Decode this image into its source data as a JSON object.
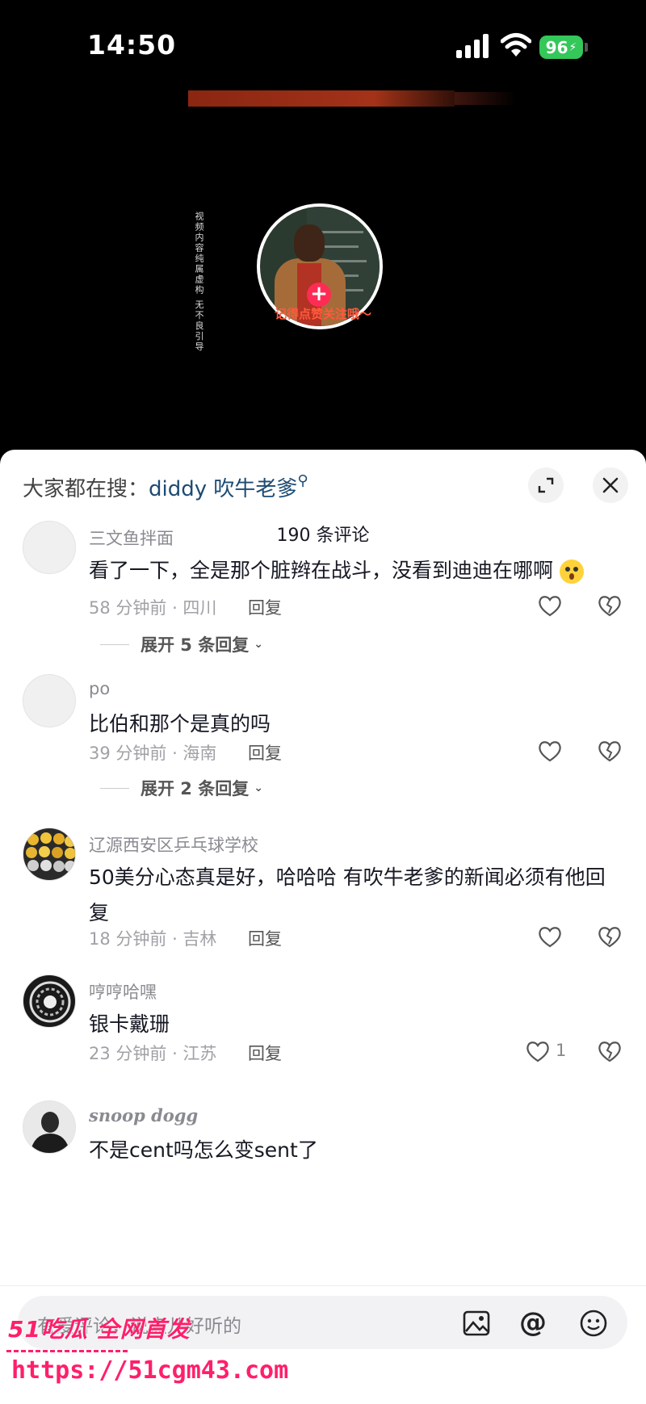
{
  "status_bar": {
    "time": "14:50",
    "battery": "96"
  },
  "video": {
    "vertical_note": "视频内容纯属虚构 无不良引导",
    "follow_hint": "记得点赞关注哦～",
    "follow_plus": "+"
  },
  "sheet": {
    "search_prefix": "大家都在搜：",
    "search_term": "diddy 吹牛老爹",
    "comment_count": "190 条评论"
  },
  "comments": [
    {
      "user": "三文鱼拌面",
      "text": "看了一下，全是那个脏辫在战斗，没看到迪迪在哪啊",
      "time_location": "58 分钟前 · 四川",
      "reply": "回复",
      "expand": "展开 5 条回复"
    },
    {
      "user": "po",
      "text": "比伯和那个是真的吗",
      "time_location": "39 分钟前 · 海南",
      "reply": "回复",
      "expand": "展开 2 条回复"
    },
    {
      "user": "辽源西安区乒乓球学校",
      "text": "50美分心态真是好，哈哈哈 有吹牛老爹的新闻必须有他回复",
      "time_location": "18 分钟前 · 吉林",
      "reply": "回复"
    },
    {
      "user": "哼哼哈嘿",
      "text": "银卡戴珊",
      "time_location": "23 分钟前 · 江苏",
      "reply": "回复",
      "likes": "1"
    },
    {
      "user": "snoop dogg",
      "text": "不是cent吗怎么变sent了"
    }
  ],
  "input": {
    "placeholder": "有爱评论，说点儿好听的"
  },
  "watermark": {
    "brand": "51吃瓜 全网首发",
    "url": "https://51cgm43.com"
  },
  "colors": {
    "accent_red": "#fe2c55",
    "battery_green": "#34c759",
    "search_blue": "#1d4b73",
    "watermark_pink": "#ff1f6a"
  }
}
